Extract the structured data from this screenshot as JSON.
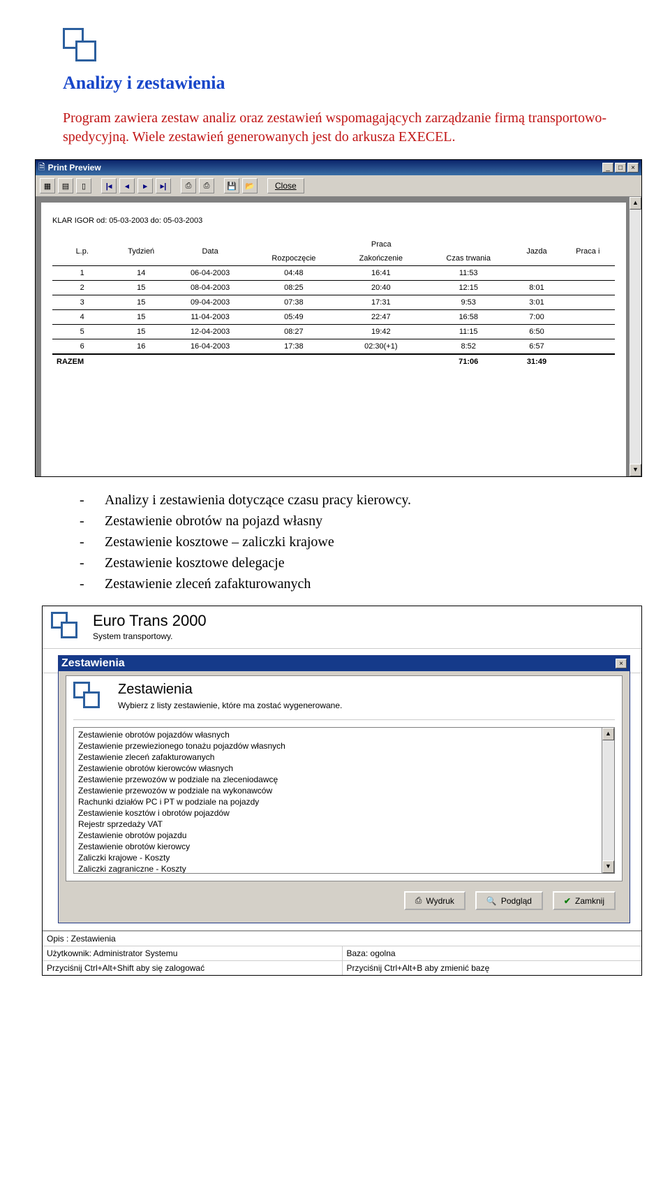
{
  "heading": "Analizy  i zestawienia",
  "paragraph": "Program zawiera zestaw analiz oraz zestawień wspomagających zarządzanie firmą transportowo-spedycyjną. Wiele zestawień generowanych jest do arkusza EXECEL.",
  "print_preview": {
    "title": "Print Preview",
    "close": "Close",
    "report_title": "KLAR IGOR   od: 05-03-2003 do: 05-03-2003",
    "headers": {
      "lp": "L.p.",
      "tydzien": "Tydzień",
      "data": "Data",
      "praca": "Praca",
      "rozp": "Rozpoczęcie",
      "zak": "Zakończenie",
      "czas": "Czas trwania",
      "jazda": "Jazda",
      "pracai": "Praca i"
    },
    "rows": [
      {
        "lp": "1",
        "tyd": "14",
        "data": "06-04-2003",
        "rozp": "04:48",
        "zak": "16:41",
        "czas": "11:53",
        "jazda": "",
        "pracai": ""
      },
      {
        "lp": "2",
        "tyd": "15",
        "data": "08-04-2003",
        "rozp": "08:25",
        "zak": "20:40",
        "czas": "12:15",
        "jazda": "8:01",
        "pracai": ""
      },
      {
        "lp": "3",
        "tyd": "15",
        "data": "09-04-2003",
        "rozp": "07:38",
        "zak": "17:31",
        "czas": "9:53",
        "jazda": "3:01",
        "pracai": ""
      },
      {
        "lp": "4",
        "tyd": "15",
        "data": "11-04-2003",
        "rozp": "05:49",
        "zak": "22:47",
        "czas": "16:58",
        "jazda": "7:00",
        "pracai": ""
      },
      {
        "lp": "5",
        "tyd": "15",
        "data": "12-04-2003",
        "rozp": "08:27",
        "zak": "19:42",
        "czas": "11:15",
        "jazda": "6:50",
        "pracai": ""
      },
      {
        "lp": "6",
        "tyd": "16",
        "data": "16-04-2003",
        "rozp": "17:38",
        "zak": "02:30(+1)",
        "czas": "8:52",
        "jazda": "6:57",
        "pracai": ""
      }
    ],
    "total_label": "RAZEM",
    "total_czas": "71:06",
    "total_jazda": "31:49"
  },
  "bullets": [
    "Analizy i zestawienia dotyczące czasu pracy kierowcy.",
    "Zestawienie obrotów na pojazd własny",
    "Zestawienie kosztowe – zaliczki krajowe",
    "Zestawienie kosztowe delegacje",
    "Zestawienie zleceń zafakturowanych"
  ],
  "app": {
    "title": "Euro Trans 2000",
    "subtitle": "System transportowy.",
    "dialog": {
      "title": "Zestawienia",
      "heading": "Zestawienia",
      "sub": "Wybierz z listy zestawienie, które ma zostać wygenerowane.",
      "items": [
        "Zestawienie obrotów pojazdów własnych",
        "Zestawienie przewiezionego tonażu pojazdów własnych",
        "Zestawienie zleceń zafakturowanych",
        "Zestawienie obrotów kierowców własnych",
        "Zestawienie przewozów w podziale na zleceniodawcę",
        "Zestawienie przewozów w podziale na wykonawców",
        "Rachunki działów PC i PT w podziale na pojazdy",
        "Zestawienie kosztów i obrotów pojazdów",
        "Rejestr sprzedaży VAT",
        "Zestawienie obrotów pojazdu",
        "Zestawienie obrotów kierowcy",
        "Zaliczki krajowe - Koszty",
        "Zaliczki zagraniczne - Koszty"
      ],
      "btn_print": "Wydruk",
      "btn_preview": "Podgląd",
      "btn_close": "Zamknij"
    },
    "status": {
      "opis": "Opis : Zestawienia",
      "user": "Użytkownik: Administrator Systemu",
      "baza": "Baza: ogolna",
      "hint1": "Przyciśnij Ctrl+Alt+Shift aby się zalogować",
      "hint2": "Przyciśnij Ctrl+Alt+B aby zmienić bazę"
    }
  }
}
